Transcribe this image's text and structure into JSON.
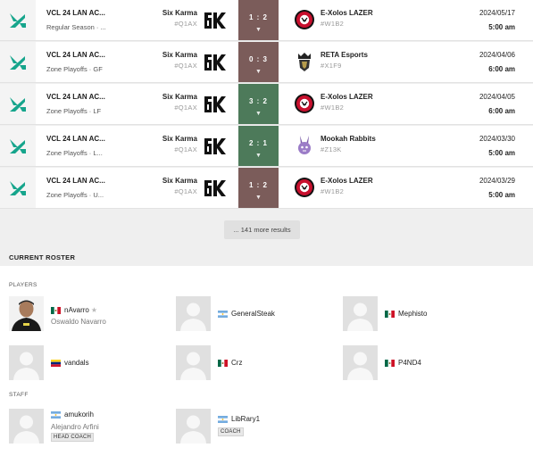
{
  "matches": [
    {
      "event": "VCL 24 LAN AC...",
      "stage": "Regular Season · ...",
      "team1": "Six Karma",
      "team1_tag": "#Q1AX",
      "score": "1 : 2",
      "result": "loss",
      "team2": "E-Xolos LAZER",
      "team2_tag": "#W1B2",
      "team2_logo": "xolos-logo",
      "date": "2024/05/17",
      "time": "5:00 am"
    },
    {
      "event": "VCL 24 LAN AC...",
      "stage": "Zone Playoffs · GF",
      "team1": "Six Karma",
      "team1_tag": "#Q1AX",
      "score": "0 : 3",
      "result": "loss",
      "team2": "RETA Esports",
      "team2_tag": "#X1F9",
      "team2_logo": "reta-logo",
      "date": "2024/04/06",
      "time": "6:00 am"
    },
    {
      "event": "VCL 24 LAN AC...",
      "stage": "Zone Playoffs · LF",
      "team1": "Six Karma",
      "team1_tag": "#Q1AX",
      "score": "3 : 2",
      "result": "win",
      "team2": "E-Xolos LAZER",
      "team2_tag": "#W1B2",
      "team2_logo": "xolos-logo",
      "date": "2024/04/05",
      "time": "6:00 am"
    },
    {
      "event": "VCL 24 LAN AC...",
      "stage": "Zone Playoffs · L...",
      "team1": "Six Karma",
      "team1_tag": "#Q1AX",
      "score": "2 : 1",
      "result": "win",
      "team2": "Mookah Rabbits",
      "team2_tag": "#Z13K",
      "team2_logo": "rabbit-logo",
      "date": "2024/03/30",
      "time": "5:00 am"
    },
    {
      "event": "VCL 24 LAN AC...",
      "stage": "Zone Playoffs · U...",
      "team1": "Six Karma",
      "team1_tag": "#Q1AX",
      "score": "1 : 2",
      "result": "loss",
      "team2": "E-Xolos LAZER",
      "team2_tag": "#W1B2",
      "team2_logo": "xolos-logo",
      "date": "2024/03/29",
      "time": "5:00 am"
    }
  ],
  "more_results": "... 141 more results",
  "roster": {
    "title": "CURRENT ROSTER",
    "players_label": "PLAYERS",
    "staff_label": "STAFF",
    "players": [
      {
        "handle": "nAvarro",
        "real_name": "Oswaldo Navarro",
        "flag": "mx",
        "captain": true,
        "photo": true
      },
      {
        "handle": "GeneralSteak",
        "real_name": "",
        "flag": "ar",
        "captain": false,
        "photo": false
      },
      {
        "handle": "Mephisto",
        "real_name": "",
        "flag": "mx",
        "captain": false,
        "photo": false
      },
      {
        "handle": "vandals",
        "real_name": "",
        "flag": "ve",
        "captain": false,
        "photo": false
      },
      {
        "handle": "Crz",
        "real_name": "",
        "flag": "mx",
        "captain": false,
        "photo": false
      },
      {
        "handle": "P4ND4",
        "real_name": "",
        "flag": "mx",
        "captain": false,
        "photo": false
      }
    ],
    "staff": [
      {
        "handle": "amukorih",
        "real_name": "Alejandro Arfini",
        "flag": "ar",
        "role": "HEAD COACH"
      },
      {
        "handle": "LibRary1",
        "real_name": "",
        "flag": "ar",
        "role": "COACH"
      }
    ]
  },
  "colors": {
    "win": "#4d7a5a",
    "loss": "#7b5c5a",
    "valorant_teal": "#16a58c"
  }
}
